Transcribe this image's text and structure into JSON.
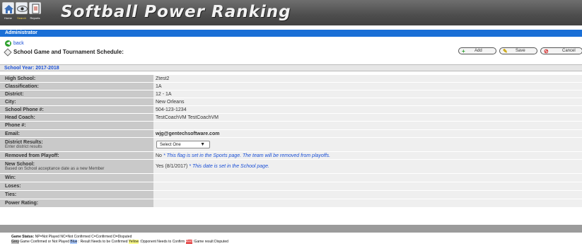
{
  "header": {
    "title": "Softball Power Ranking",
    "nav": [
      {
        "label": "Home",
        "icon": "house-icon"
      },
      {
        "label": "Search",
        "icon": "eye-icon"
      },
      {
        "label": "Reports",
        "icon": "document-icon"
      }
    ]
  },
  "admin_bar": {
    "label": "Administrator"
  },
  "toolbar": {
    "back_label": "back",
    "schedule_label": "School Game and Tournament Schedule:",
    "add_label": "Add",
    "save_label": "Save",
    "cancel_label": "Cancel"
  },
  "school_year": {
    "label": "School Year: 2017-2018"
  },
  "form": {
    "high_school": {
      "label": "High School:",
      "value": "Ztest2"
    },
    "classification": {
      "label": "Classification:",
      "value": "1A"
    },
    "district": {
      "label": "District:",
      "value": "12 - 1A"
    },
    "city": {
      "label": "City:",
      "value": "New Orleans"
    },
    "school_phone": {
      "label": "School Phone #:",
      "value": "504-123-1234"
    },
    "head_coach": {
      "label": "Head Coach:",
      "value": "TestCoachVM TestCoachVM"
    },
    "phone": {
      "label": "Phone #:",
      "value": ""
    },
    "email": {
      "label": "Email:",
      "value": "wjg@gentechsoftware.com"
    },
    "district_results": {
      "label": "District Results:",
      "sub": "Enter district results",
      "selected": "Select One"
    },
    "removed_from_playoff": {
      "label": "Removed from Playoff:",
      "value": "No",
      "note": "* This flag is set in the Sports page. The team will be removed from playoffs."
    },
    "new_school": {
      "label": "New School:",
      "sub": "Based on School acceptance date as a new Member",
      "value": "Yes (8/1/2017)",
      "note": "* This date is set in the School page."
    },
    "win": {
      "label": "Win:",
      "value": ""
    },
    "loses": {
      "label": "Loses:",
      "value": ""
    },
    "ties": {
      "label": "Ties:",
      "value": ""
    },
    "power_rating": {
      "label": "Power Rating:",
      "value": ""
    }
  },
  "legend": {
    "status_title": "Game Status:",
    "status_text": "NP=Not Played NC=Not Confirmed C=Confirmed D=Disputed",
    "gray_label": "Grey",
    "gray_text": "Game Confirmed or Not Played",
    "blue_label": "Blue",
    "blue_text": ": Result Needs to be Confirmed",
    "yellow_label": "Yellow",
    "yellow_text": ":Opponent Needs to Confirm",
    "red_label": "Red",
    "red_text": ":Game result Disputed"
  }
}
